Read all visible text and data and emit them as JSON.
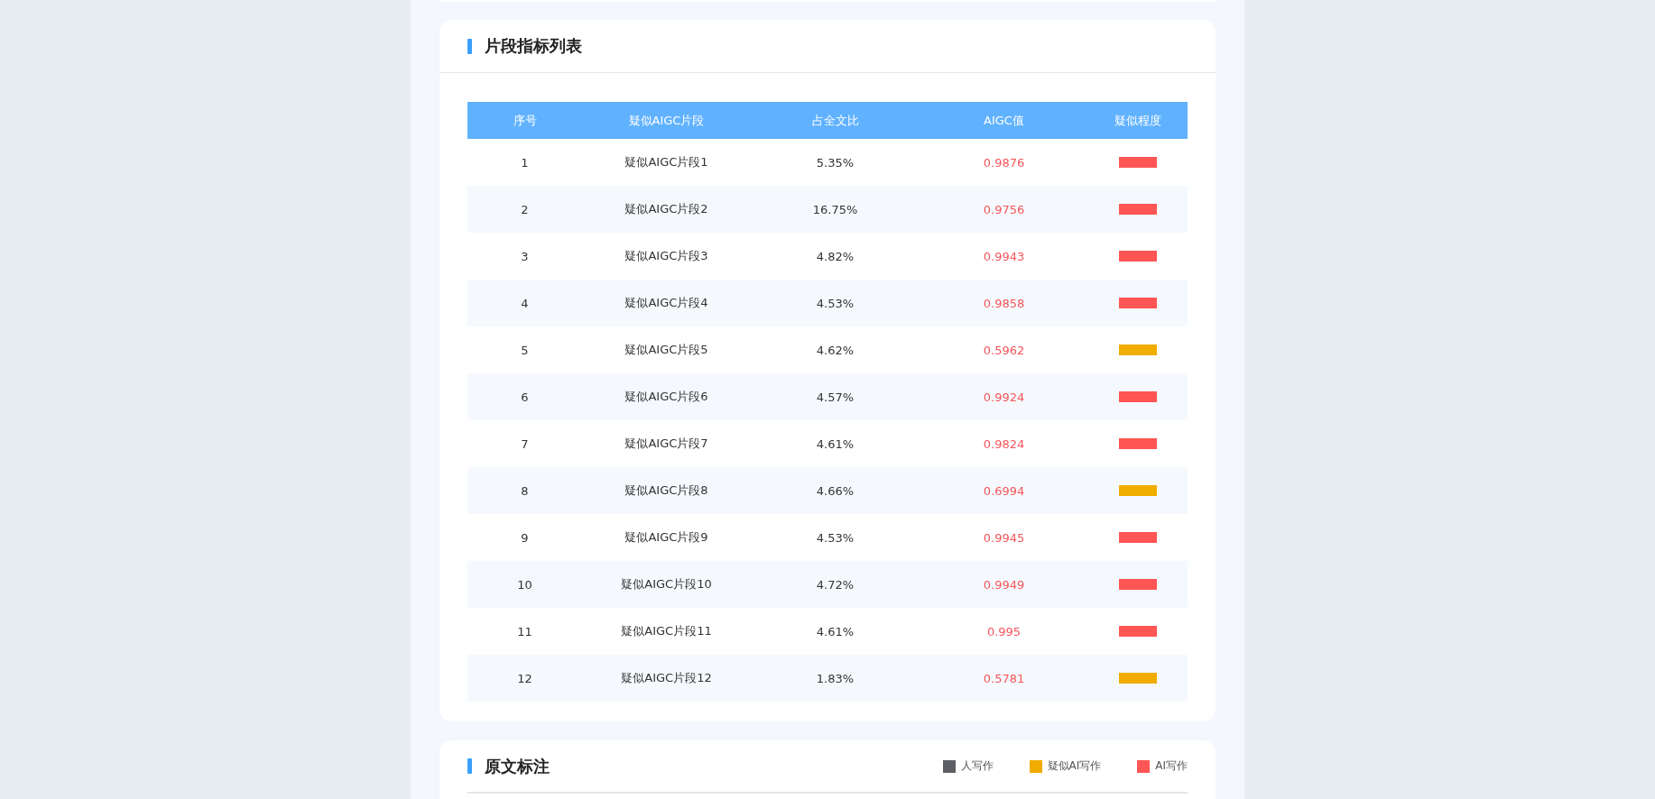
{
  "segment_table": {
    "title": "片段指标列表",
    "columns": [
      "序号",
      "疑似AIGC片段",
      "占全文比",
      "AIGC值",
      "疑似程度"
    ],
    "rows": [
      {
        "index": "1",
        "segment": "疑似AIGC片段1",
        "share": "5.35%",
        "aigc": "0.9876",
        "color": "#ff5555"
      },
      {
        "index": "2",
        "segment": "疑似AIGC片段2",
        "share": "16.75%",
        "aigc": "0.9756",
        "color": "#ff5555"
      },
      {
        "index": "3",
        "segment": "疑似AIGC片段3",
        "share": "4.82%",
        "aigc": "0.9943",
        "color": "#ff5555"
      },
      {
        "index": "4",
        "segment": "疑似AIGC片段4",
        "share": "4.53%",
        "aigc": "0.9858",
        "color": "#ff5555"
      },
      {
        "index": "5",
        "segment": "疑似AIGC片段5",
        "share": "4.62%",
        "aigc": "0.5962",
        "color": "#f0ad00"
      },
      {
        "index": "6",
        "segment": "疑似AIGC片段6",
        "share": "4.57%",
        "aigc": "0.9924",
        "color": "#ff5555"
      },
      {
        "index": "7",
        "segment": "疑似AIGC片段7",
        "share": "4.61%",
        "aigc": "0.9824",
        "color": "#ff5555"
      },
      {
        "index": "8",
        "segment": "疑似AIGC片段8",
        "share": "4.66%",
        "aigc": "0.6994",
        "color": "#f0ad00"
      },
      {
        "index": "9",
        "segment": "疑似AIGC片段9",
        "share": "4.53%",
        "aigc": "0.9945",
        "color": "#ff5555"
      },
      {
        "index": "10",
        "segment": "疑似AIGC片段10",
        "share": "4.72%",
        "aigc": "0.9949",
        "color": "#ff5555"
      },
      {
        "index": "11",
        "segment": "疑似AIGC片段11",
        "share": "4.61%",
        "aigc": "0.995",
        "color": "#ff5555"
      },
      {
        "index": "12",
        "segment": "疑似AIGC片段12",
        "share": "1.83%",
        "aigc": "0.5781",
        "color": "#f0ad00"
      }
    ]
  },
  "annotation": {
    "title": "原文标注",
    "legend": [
      {
        "label": "人写作",
        "color": "#5f5f66"
      },
      {
        "label": "疑似AI写作",
        "color": "#f0ad00"
      },
      {
        "label": "AI写作",
        "color": "#ff5555"
      }
    ]
  }
}
